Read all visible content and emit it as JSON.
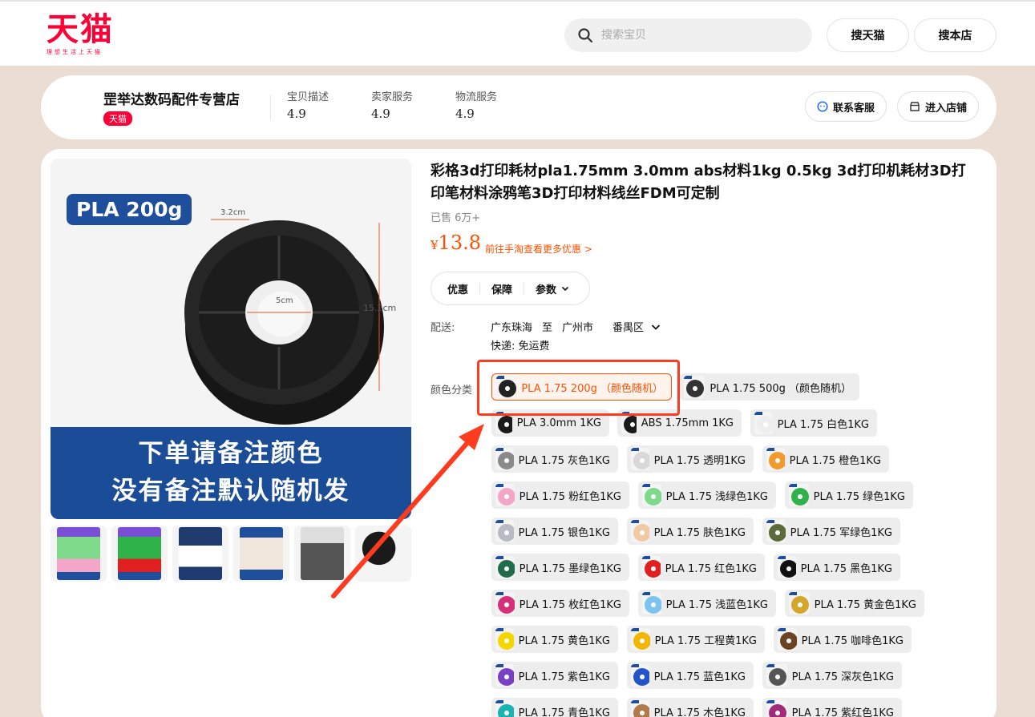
{
  "header": {
    "logo_main": "天猫",
    "logo_sub": "理想生活上天猫",
    "search_placeholder": "搜索宝贝",
    "btn_search_tmall": "搜天猫",
    "btn_search_store": "搜本店"
  },
  "shop": {
    "name": "罡举达数码配件专营店",
    "badge": "天猫",
    "metrics": [
      {
        "label": "宝贝描述",
        "value": "4.9"
      },
      {
        "label": "卖家服务",
        "value": "4.9"
      },
      {
        "label": "物流服务",
        "value": "4.9"
      }
    ],
    "btn_contact": "联系客服",
    "btn_enter": "进入店铺"
  },
  "gallery": {
    "tag": "PLA 200g",
    "dim_width": "3.2cm",
    "dim_hole": "5cm",
    "dim_height": "15.2cm",
    "banner_line1": "下单请备注颜色",
    "banner_line2": "没有备注默认随机发"
  },
  "product": {
    "title": "彩格3d打印耗材pla1.75mm 3.0mm abs材料1kg 0.5kg 3d打印机耗材3D打印笔材料涂鸦笔3D打印材料线丝FDM可定制",
    "sold": "已售 6万+",
    "price_symbol": "¥",
    "price": "13.8",
    "promo": "前往手淘查看更多优惠 >",
    "tabs": [
      "优惠",
      "保障",
      "参数"
    ],
    "ship_label": "配送:",
    "ship_from": "广东珠海",
    "ship_to_word": "至",
    "ship_city": "广州市",
    "ship_district": "番禺区",
    "ship_note": "快递: 免运费",
    "color_label": "颜色分类"
  },
  "skus": [
    {
      "label": "PLA 1.75 200g （颜色随机）",
      "color": "#222222",
      "selected": true
    },
    {
      "label": "PLA 1.75 500g （颜色随机）",
      "color": "#333333",
      "selected": false
    },
    {
      "label": "PLA 3.0mm 1KG",
      "color": "#1a1a1a",
      "selected": false
    },
    {
      "label": "ABS 1.75mm 1KG",
      "color": "#1a1a1a",
      "selected": false
    },
    {
      "label": "PLA 1.75 白色1KG",
      "color": "#eeeeee",
      "selected": false
    },
    {
      "label": "PLA 1.75 灰色1KG",
      "color": "#8a8a8a",
      "selected": false
    },
    {
      "label": "PLA 1.75 透明1KG",
      "color": "#d8d8d8",
      "selected": false
    },
    {
      "label": "PLA 1.75 橙色1KG",
      "color": "#f39a2b",
      "selected": false
    },
    {
      "label": "PLA 1.75 粉红色1KG",
      "color": "#f4a6c8",
      "selected": false
    },
    {
      "label": "PLA 1.75 浅绿色1KG",
      "color": "#7fd98a",
      "selected": false
    },
    {
      "label": "PLA 1.75 绿色1KG",
      "color": "#2fb24a",
      "selected": false
    },
    {
      "label": "PLA 1.75 银色1KG",
      "color": "#b8bcc2",
      "selected": false
    },
    {
      "label": "PLA 1.75 肤色1KG",
      "color": "#f1c9a5",
      "selected": false
    },
    {
      "label": "PLA 1.75 军绿色1KG",
      "color": "#5c6b3a",
      "selected": false
    },
    {
      "label": "PLA 1.75 墨绿色1KG",
      "color": "#1f6b4a",
      "selected": false
    },
    {
      "label": "PLA 1.75 红色1KG",
      "color": "#e02020",
      "selected": false
    },
    {
      "label": "PLA 1.75 黑色1KG",
      "color": "#111111",
      "selected": false
    },
    {
      "label": "PLA 1.75 枚红色1KG",
      "color": "#d6307a",
      "selected": false
    },
    {
      "label": "PLA 1.75 浅蓝色1KG",
      "color": "#7cc3f0",
      "selected": false
    },
    {
      "label": "PLA 1.75 黄金色1KG",
      "color": "#d4a72c",
      "selected": false
    },
    {
      "label": "PLA 1.75 黄色1KG",
      "color": "#f5d600",
      "selected": false
    },
    {
      "label": "PLA 1.75 工程黄1KG",
      "color": "#f2b705",
      "selected": false
    },
    {
      "label": "PLA 1.75 咖啡色1KG",
      "color": "#6b4423",
      "selected": false
    },
    {
      "label": "PLA 1.75 紫色1KG",
      "color": "#7a3fc2",
      "selected": false
    },
    {
      "label": "PLA 1.75 蓝色1KG",
      "color": "#2454c7",
      "selected": false
    },
    {
      "label": "PLA 1.75 深灰色1KG",
      "color": "#555555",
      "selected": false
    },
    {
      "label": "PLA 1.75 青色1KG",
      "color": "#19b3b3",
      "selected": false
    },
    {
      "label": "PLA 1.75 木色1KG",
      "color": "#b07a4a",
      "selected": false
    },
    {
      "label": "PLA 1.75 紫红色1KG",
      "color": "#a02c7a",
      "selected": false
    }
  ],
  "colors": {
    "brand": "#ff0036",
    "accent": "#ff5000",
    "annotation": "#ff3b1f"
  }
}
